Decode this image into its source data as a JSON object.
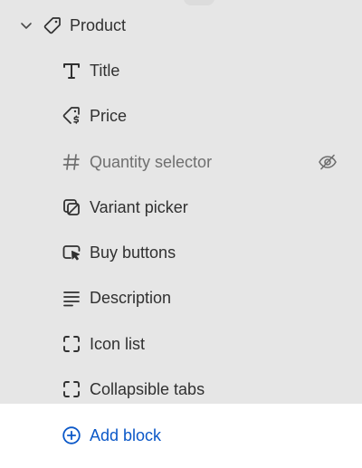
{
  "product_section": {
    "label": "Product",
    "expand_icon": "chevron-down-icon",
    "section_icon": "tag-icon"
  },
  "blocks": [
    {
      "label": "Title",
      "icon": "text-type-icon",
      "hidden": false
    },
    {
      "label": "Price",
      "icon": "price-tag-icon",
      "hidden": false
    },
    {
      "label": "Quantity selector",
      "icon": "hash-icon",
      "hidden": true
    },
    {
      "label": "Variant picker",
      "icon": "variant-picker-icon",
      "hidden": false
    },
    {
      "label": "Buy buttons",
      "icon": "buy-button-icon",
      "hidden": false
    },
    {
      "label": "Description",
      "icon": "text-align-left-icon",
      "hidden": false
    },
    {
      "label": "Icon list",
      "icon": "dashed-square-icon",
      "hidden": false
    },
    {
      "label": "Collapsible tabs",
      "icon": "dashed-square-icon",
      "hidden": false
    }
  ],
  "add_block": {
    "label": "Add block",
    "icon": "plus-circle-icon",
    "accent_color": "#0b58c8"
  },
  "colors": {
    "background": "#e6e6e6",
    "text": "#303030",
    "muted_text": "#6f6f6f",
    "add_panel_background": "#ffffff"
  }
}
